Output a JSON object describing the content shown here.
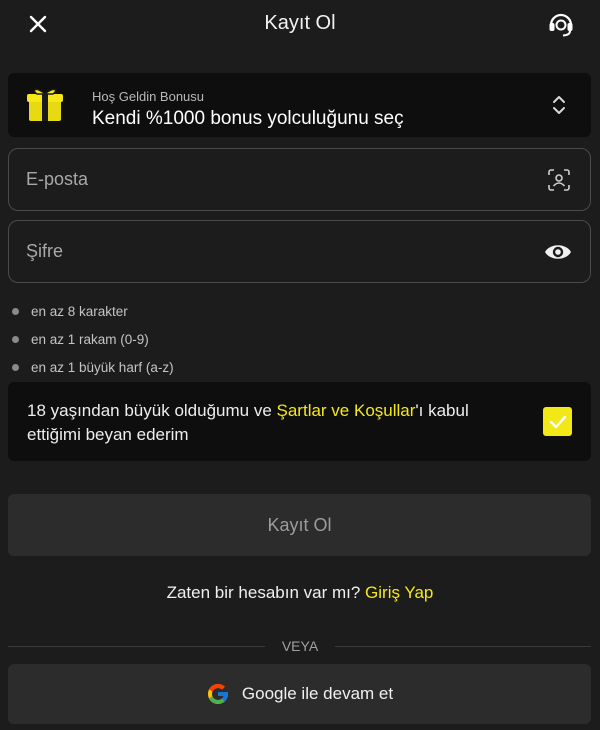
{
  "header": {
    "title": "Kayıt Ol",
    "close_icon": "close-icon",
    "support_icon": "headset-icon"
  },
  "bonus": {
    "label": "Hoş Geldin Bonusu",
    "selection": "Kendi %1000 bonus yolculuğunu seç",
    "icon": "gift-icon"
  },
  "form": {
    "email_placeholder": "E-posta",
    "email_value": "",
    "password_placeholder": "Şifre",
    "password_value": ""
  },
  "password_rules": [
    "en az 8 karakter",
    "en az 1 rakam (0-9)",
    "en az 1 büyük harf (a-z)"
  ],
  "consent": {
    "text_before": "18 yaşından büyük olduğumu ve ",
    "terms_link": "Şartlar ve Koşullar",
    "text_after": "'ı kabul ettiğimi beyan ederim",
    "checked": true
  },
  "register_button": "Kayıt Ol",
  "login": {
    "prompt": "Zaten bir hesabın var mı?",
    "link": "Giriş Yap"
  },
  "or_label": "VEYA",
  "google_button": "Google ile devam et",
  "colors": {
    "background": "#1c1c1c",
    "card": "#0e0e0e",
    "accent": "#f6e816",
    "button": "#2c2c2c"
  }
}
